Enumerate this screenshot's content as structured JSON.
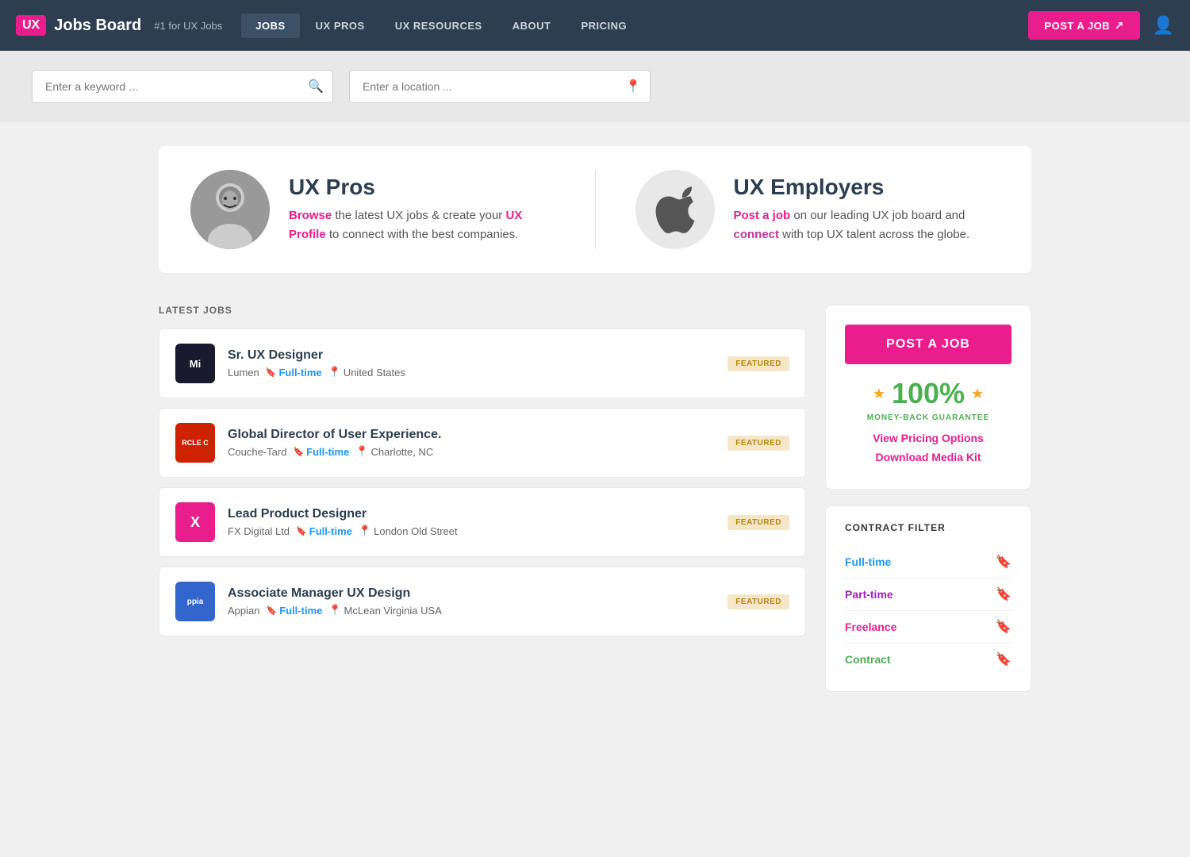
{
  "navbar": {
    "logo_text": "UX",
    "brand_name": "Jobs Board",
    "tagline": "#1 for UX Jobs",
    "nav_items": [
      {
        "label": "JOBS",
        "active": true
      },
      {
        "label": "UX PROS",
        "active": false
      },
      {
        "label": "UX RESOURCES",
        "active": false
      },
      {
        "label": "ABOUT",
        "active": false
      },
      {
        "label": "PRICING",
        "active": false
      }
    ],
    "post_job_label": "POST A JOB",
    "user_icon": "👤"
  },
  "search": {
    "keyword_placeholder": "Enter a keyword ...",
    "location_placeholder": "Enter a location ..."
  },
  "promo": {
    "left": {
      "heading": "UX Pros",
      "text_before_browse": "",
      "browse": "Browse",
      "text_after_browse": " the latest UX jobs & create your ",
      "ux_profile": "UX Profile",
      "text_after_profile": " to connect with the best companies."
    },
    "right": {
      "heading": "UX Employers",
      "post_a_job": "Post a job",
      "text_after_post": " on our leading UX job board and ",
      "connect": "connect",
      "text_after_connect": " with top UX talent across the globe."
    }
  },
  "jobs_section": {
    "title": "LATEST JOBS",
    "jobs": [
      {
        "id": 1,
        "logo_initials": "Mi",
        "logo_class": "lumen",
        "title": "Sr. UX Designer",
        "company": "Lumen",
        "type": "Full-time",
        "location": "United States",
        "featured": true
      },
      {
        "id": 2,
        "logo_initials": "RCLE C",
        "logo_class": "couche",
        "title": "Global Director of User Experience.",
        "company": "Couche-Tard",
        "type": "Full-time",
        "location": "Charlotte, NC",
        "featured": true
      },
      {
        "id": 3,
        "logo_initials": "X",
        "logo_class": "fx",
        "title": "Lead Product Designer",
        "company": "FX Digital Ltd",
        "type": "Full-time",
        "location": "London Old Street",
        "featured": true
      },
      {
        "id": 4,
        "logo_initials": "ppia",
        "logo_class": "appian",
        "title": "Associate Manager UX Design",
        "company": "Appian",
        "type": "Full-time",
        "location": "McLean Virginia USA",
        "featured": true
      }
    ]
  },
  "sidebar": {
    "post_job_label": "POST A JOB",
    "guarantee_pct": "100%",
    "guarantee_label": "MONEY-BACK GUARANTEE",
    "view_pricing": "View Pricing Options",
    "download_kit": "Download Media Kit",
    "contract_filter_title": "CONTRACT FILTER",
    "filters": [
      {
        "label": "Full-time",
        "class": "fulltime",
        "bookmark_class": "fb-blue"
      },
      {
        "label": "Part-time",
        "class": "parttime",
        "bookmark_class": "fb-purple"
      },
      {
        "label": "Freelance",
        "class": "freelance",
        "bookmark_class": "fb-pink"
      },
      {
        "label": "Contract",
        "class": "contract",
        "bookmark_class": "fb-green"
      }
    ]
  }
}
